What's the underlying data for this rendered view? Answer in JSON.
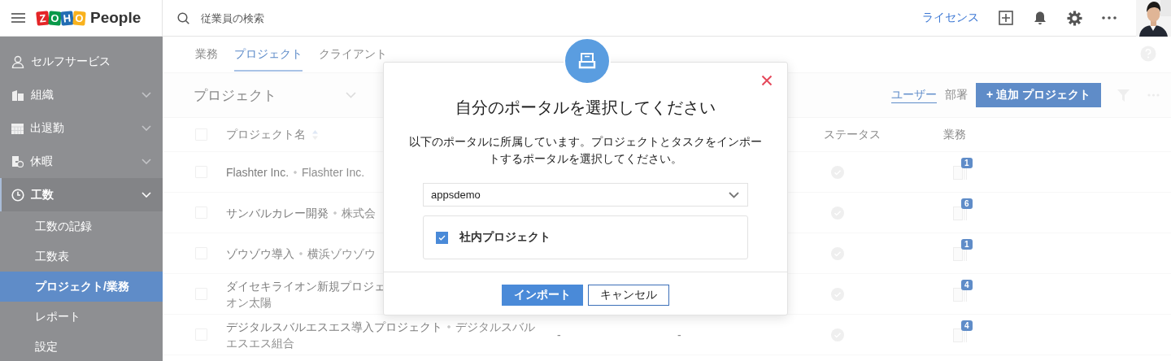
{
  "header": {
    "logo": {
      "letters": [
        {
          "text": "Z",
          "color": "#e42527"
        },
        {
          "text": "O",
          "color": "#089949"
        },
        {
          "text": "H",
          "color": "#226db4"
        },
        {
          "text": "O",
          "color": "#f9b21d"
        }
      ],
      "product": "People"
    },
    "search": {
      "placeholder": "従業員の検索"
    },
    "license_link": "ライセンス"
  },
  "sidebar": {
    "items": [
      {
        "label": "セルフサービス",
        "kind": "link",
        "selected": false
      },
      {
        "label": "組織",
        "kind": "group",
        "expanded": false,
        "selected": false
      },
      {
        "label": "出退勤",
        "kind": "group",
        "expanded": false,
        "selected": false
      },
      {
        "label": "休暇",
        "kind": "group",
        "expanded": false,
        "selected": false
      },
      {
        "label": "工数",
        "kind": "group",
        "expanded": true,
        "selected": true,
        "children": [
          {
            "label": "工数の記録",
            "selected": false
          },
          {
            "label": "工数表",
            "selected": false
          },
          {
            "label": "プロジェクト/業務",
            "selected": true
          },
          {
            "label": "レポート",
            "selected": false
          },
          {
            "label": "設定",
            "selected": false
          }
        ]
      }
    ]
  },
  "tabs": [
    {
      "label": "業務",
      "selected": false
    },
    {
      "label": "プロジェクト",
      "selected": true
    },
    {
      "label": "クライアント",
      "selected": false
    }
  ],
  "toolbar": {
    "view": "プロジェクト",
    "filters": [
      {
        "label": "ユーザー",
        "selected": true
      },
      {
        "label": "部署",
        "selected": false
      }
    ],
    "add_button": "+ 追加 プロジェクト"
  },
  "table": {
    "columns": [
      "プロジェクト名",
      "ステータス",
      "業務"
    ],
    "header_checked": false,
    "rows": [
      {
        "checked": false,
        "name": "Flashter Inc.",
        "client": "Flashter Inc.",
        "tasks": "1"
      },
      {
        "checked": false,
        "name": "サンバルカレー開発",
        "client": "株式会",
        "tasks": "6"
      },
      {
        "checked": false,
        "name": "ゾウゾウ導入",
        "client": "横浜ゾウゾウ",
        "tasks": "1"
      },
      {
        "checked": false,
        "name": "ダイセキライオン新規プロジェ",
        "wrap": "オン太陽",
        "tasks": "4"
      },
      {
        "checked": false,
        "name": "デジタルスバルエスエス導入プロジェクト",
        "client": "デジタルスバル",
        "wrap": "エスエス組合",
        "column_3": "-",
        "column_4": "-",
        "tasks": "4"
      }
    ]
  },
  "modal": {
    "title": "自分のポータルを選択してください",
    "description": "以下のポータルに所属しています。プロジェクトとタスクをインポートするポータルを選択してください。",
    "portal_select": {
      "value": "appsdemo"
    },
    "projects": [
      {
        "label": "社内プロジェクト",
        "checked": true
      }
    ],
    "buttons": [
      {
        "label": "インポート",
        "kind": "primary"
      },
      {
        "label": "キャンセル",
        "kind": "secondary"
      }
    ]
  }
}
